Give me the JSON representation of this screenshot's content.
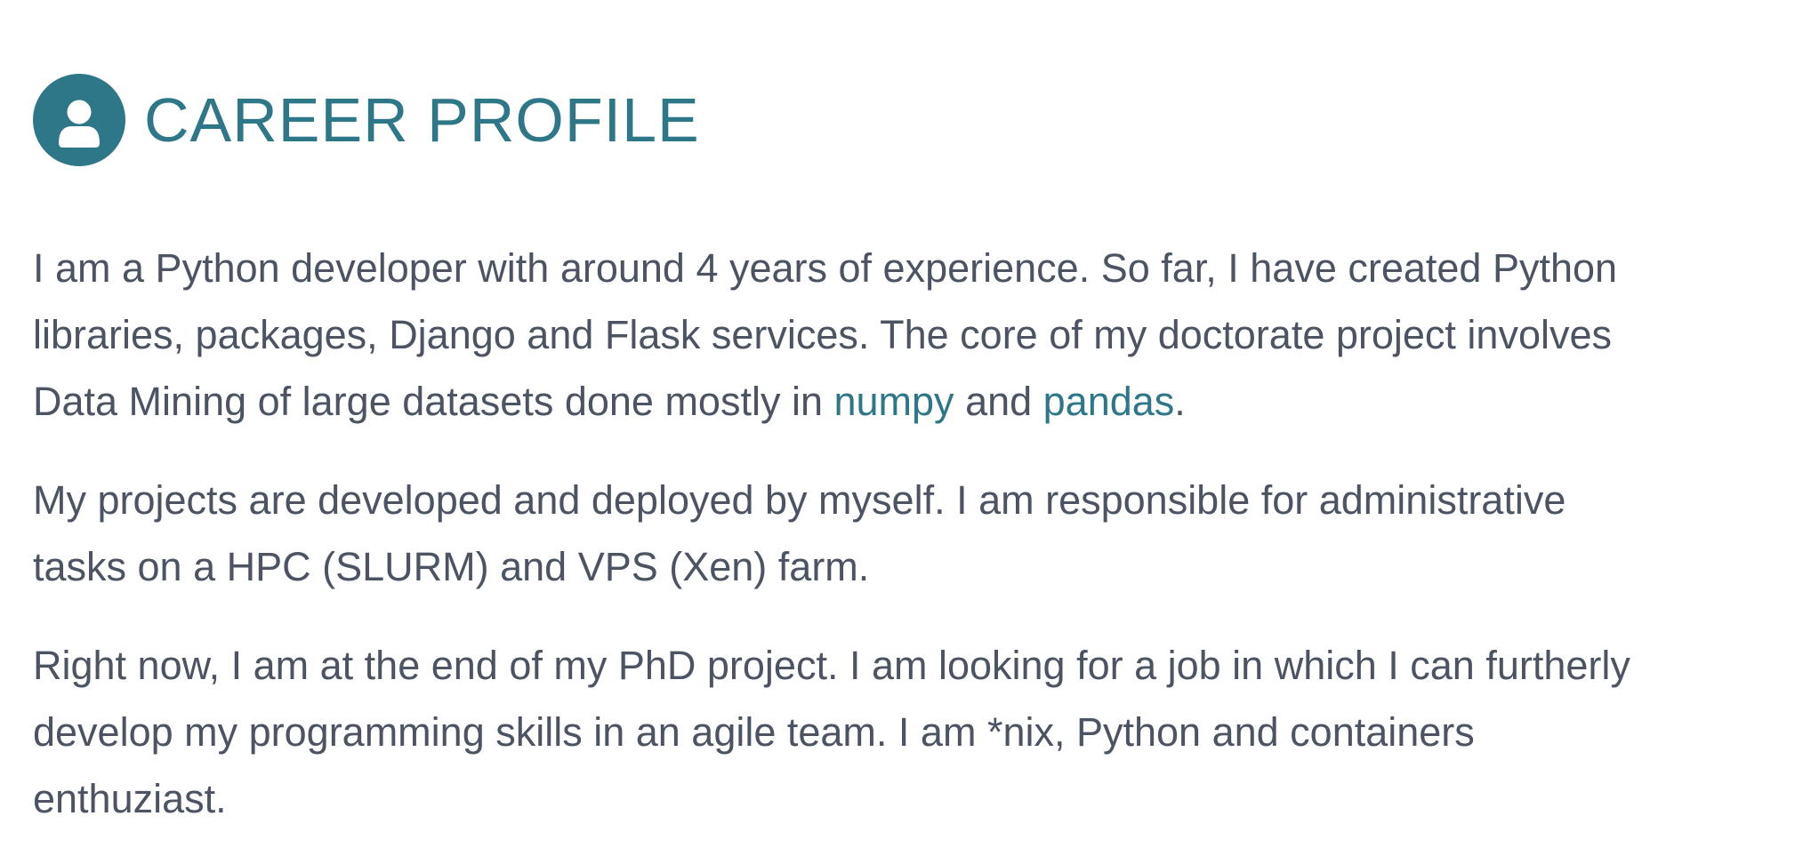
{
  "section": {
    "icon": "user-icon",
    "title": "CAREER PROFILE",
    "accent_color": "#2d7788",
    "text_color": "#4c5463"
  },
  "paragraphs": {
    "p1": {
      "line1": "I am a Python developer with around 4 years of experience. So far, I have created Python",
      "line2": "libraries, packages, Django and Flask services. The core of my doctorate project involves",
      "line3_before": "Data Mining of large datasets done mostly in ",
      "link_numpy": "numpy",
      "line3_and": " and ",
      "link_pandas": "pandas",
      "line3_end": "."
    },
    "p2": {
      "line1": "My projects are developed and deployed by myself. I am responsible for administrative",
      "line2": "tasks on a HPC (SLURM) and VPS (Xen) farm."
    },
    "p3": {
      "line1": "Right now, I am at the end of my PhD project. I am looking for a job in which I can furtherly",
      "line2": "develop my programming skills in an agile team. I am *nix, Python and containers",
      "line3": "enthuziast."
    }
  }
}
